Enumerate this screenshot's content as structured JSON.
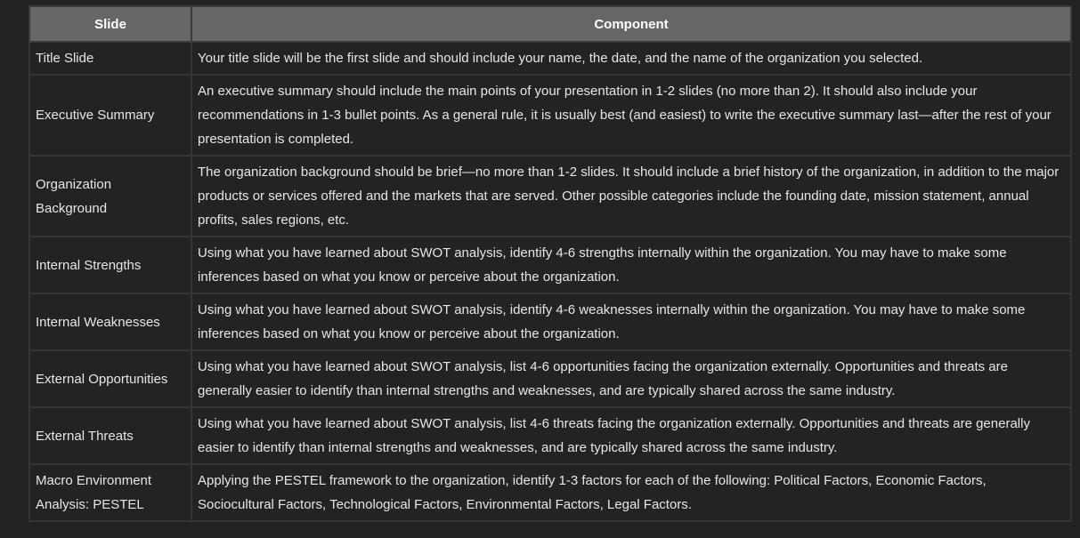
{
  "table": {
    "headers": [
      "Slide",
      "Component"
    ],
    "rows": [
      {
        "slide": "Title Slide",
        "component": "Your title slide will be the first slide and should include your name, the date, and the name of the organization you selected."
      },
      {
        "slide": "Executive Summary",
        "component": "An executive summary should include the main points of your presentation in 1-2 slides (no more than 2). It should also include your recommendations in 1-3 bullet points. As a general rule, it is usually best (and easiest) to write the executive summary last—after the rest of your presentation is completed."
      },
      {
        "slide": "Organization Background",
        "component": "The organization background should be brief—no more than 1-2 slides. It should include a brief history of the organization, in addition to the major products or services offered and the markets that are served. Other possible categories include the founding date, mission statement, annual profits, sales regions, etc."
      },
      {
        "slide": "Internal Strengths",
        "component": "Using what you have learned about SWOT analysis, identify 4-6 strengths internally within the organization. You may have to make some inferences based on what you know or perceive about the organization."
      },
      {
        "slide": "Internal Weaknesses",
        "component": "Using what you have learned about SWOT analysis, identify 4-6 weaknesses internally within the organization. You may have to make some inferences based on what you know or perceive about the organization."
      },
      {
        "slide": "External Opportunities",
        "component": "Using what you have learned about SWOT analysis, list 4-6 opportunities facing the organization externally. Opportunities and threats are generally easier to identify than internal strengths and weaknesses, and are typically shared across the same industry."
      },
      {
        "slide": "External Threats",
        "component": "Using what you have learned about SWOT analysis, list 4-6 threats facing the organization externally. Opportunities and threats are generally easier to identify than internal strengths and weaknesses, and are typically shared across the same industry."
      },
      {
        "slide": "Macro Environment Analysis: PESTEL",
        "component": "Applying the PESTEL framework to the organization, identify 1-3 factors for each of the following: Political Factors, Economic Factors, Sociocultural Factors, Technological Factors, Environmental Factors, Legal Factors."
      }
    ]
  }
}
